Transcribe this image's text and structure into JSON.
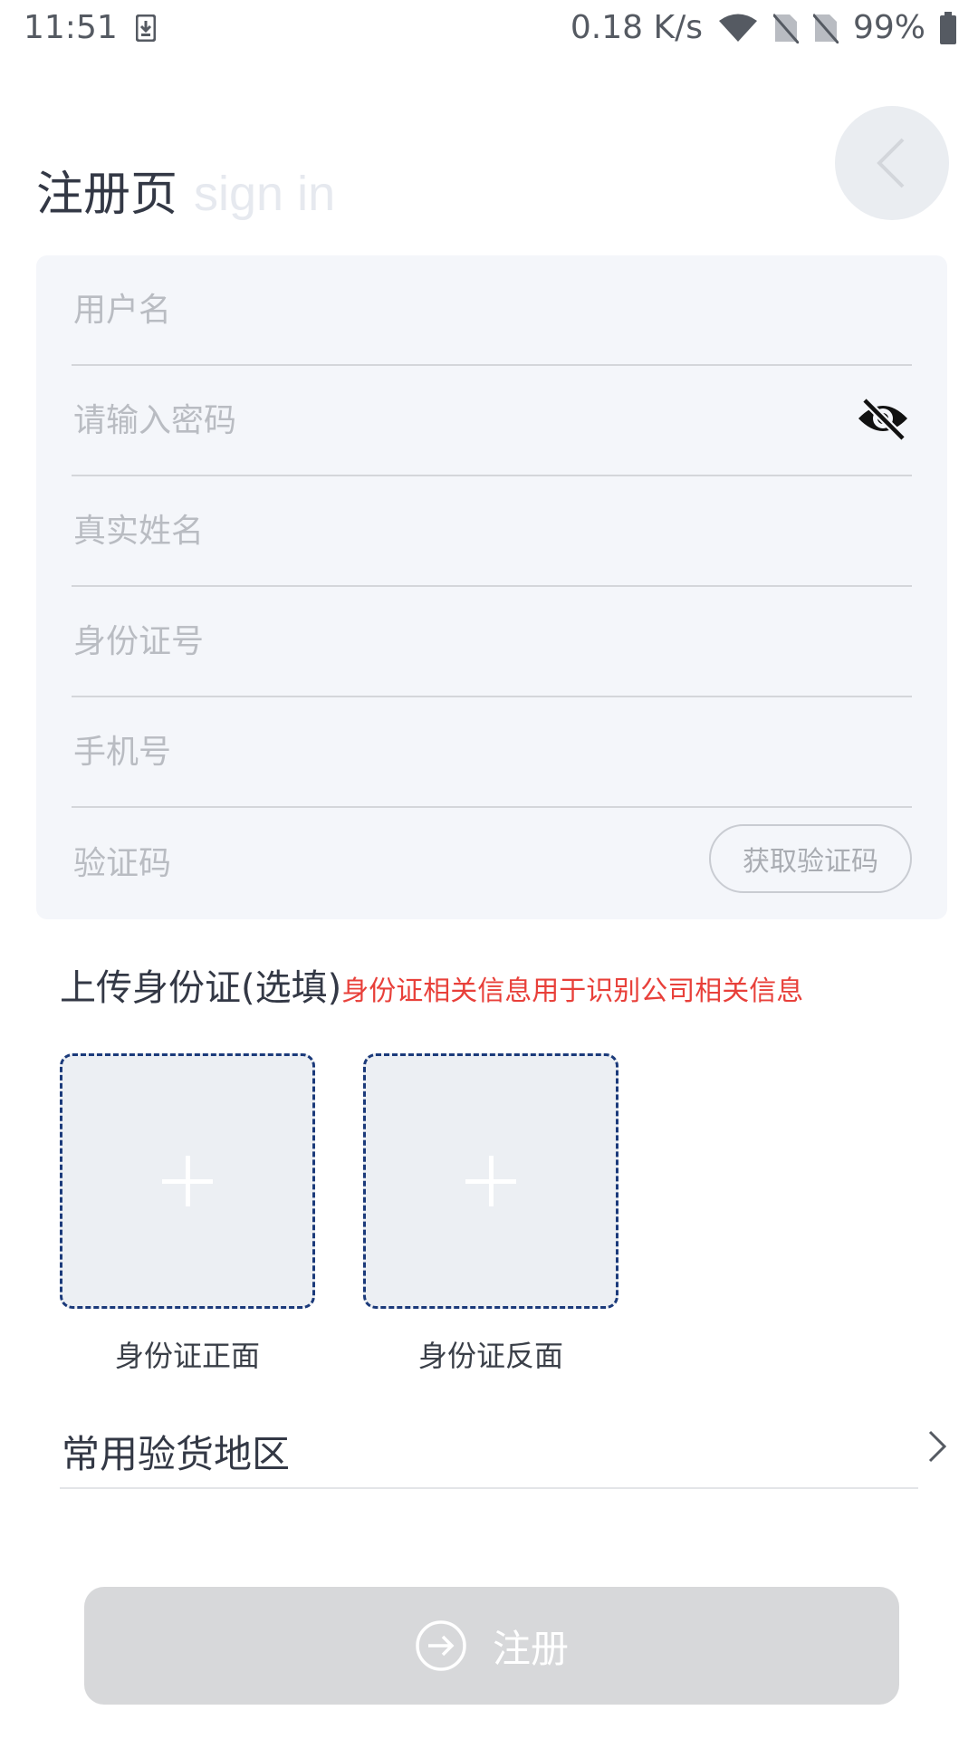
{
  "status_bar": {
    "time": "11:51",
    "network_speed": "0.18 K/s",
    "battery": "99%"
  },
  "header": {
    "title": "注册页",
    "subtitle": "sign in",
    "back_icon": "chevron-left-icon"
  },
  "form": {
    "username_placeholder": "用户名",
    "password_placeholder": "请输入密码",
    "realname_placeholder": "真实姓名",
    "idcard_placeholder": "身份证号",
    "phone_placeholder": "手机号",
    "code_placeholder": "验证码",
    "get_code_label": "获取验证码",
    "password_toggle_icon": "eye-off-icon"
  },
  "upload": {
    "title": "上传身份证(选填)",
    "hint": "身份证相关信息用于识别公司相关信息",
    "front_label": "身份证正面",
    "back_label": "身份证反面"
  },
  "region": {
    "label": "常用验货地区"
  },
  "submit": {
    "label": "注册",
    "icon": "arrow-right-circle-icon"
  },
  "colors": {
    "card_bg": "#f4f6fa",
    "hint_red": "#e8403a",
    "button_disabled": "#d7d8da",
    "upload_border": "#1b3a7a"
  }
}
